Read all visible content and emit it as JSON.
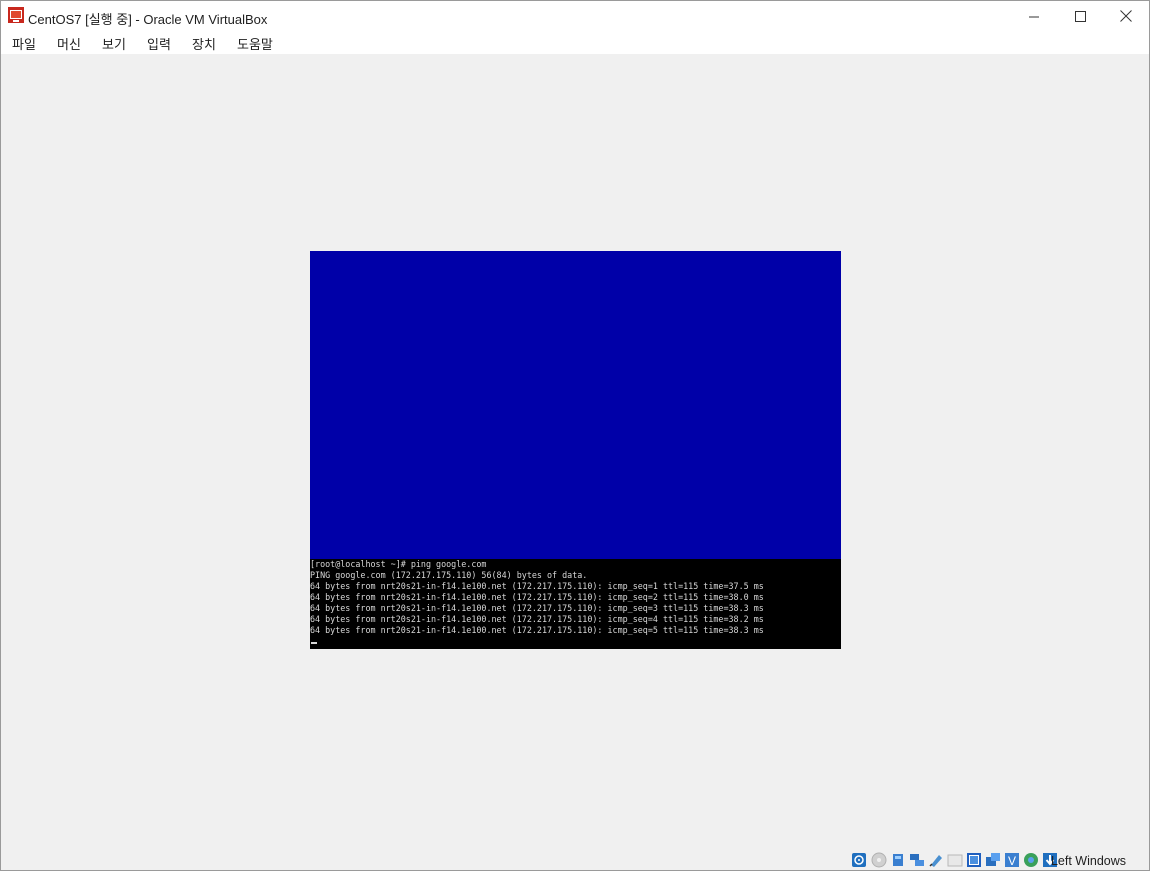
{
  "window": {
    "title": "CentOS7 [실행 중] - Oracle VM VirtualBox"
  },
  "menu": {
    "items": [
      "파일",
      "머신",
      "보기",
      "입력",
      "장치",
      "도움말"
    ]
  },
  "console": {
    "lines": [
      "[root@localhost ~]# ping google.com",
      "PING google.com (172.217.175.110) 56(84) bytes of data.",
      "64 bytes from nrt20s21-in-f14.1e100.net (172.217.175.110): icmp_seq=1 ttl=115 time=37.5 ms",
      "64 bytes from nrt20s21-in-f14.1e100.net (172.217.175.110): icmp_seq=2 ttl=115 time=38.0 ms",
      "64 bytes from nrt20s21-in-f14.1e100.net (172.217.175.110): icmp_seq=3 ttl=115 time=38.3 ms",
      "64 bytes from nrt20s21-in-f14.1e100.net (172.217.175.110): icmp_seq=4 ttl=115 time=38.2 ms",
      "64 bytes from nrt20s21-in-f14.1e100.net (172.217.175.110): icmp_seq=5 ttl=115 time=38.3 ms"
    ]
  },
  "statusbar": {
    "icons": [
      "hard-disk-icon",
      "optical-drive-icon",
      "audio-icon",
      "network-icon",
      "usb-icon",
      "shared-folders-icon",
      "display-icon",
      "recording-icon",
      "virtualization-icon",
      "cpu-icon",
      "mouse-integration-icon",
      "keyboard-capture-icon"
    ],
    "host_key": "Left Windows"
  },
  "colors": {
    "vm_background": "#0000a8",
    "console_background": "#000000",
    "console_text": "#d8d8d8",
    "window_background": "#f0f0f0"
  }
}
